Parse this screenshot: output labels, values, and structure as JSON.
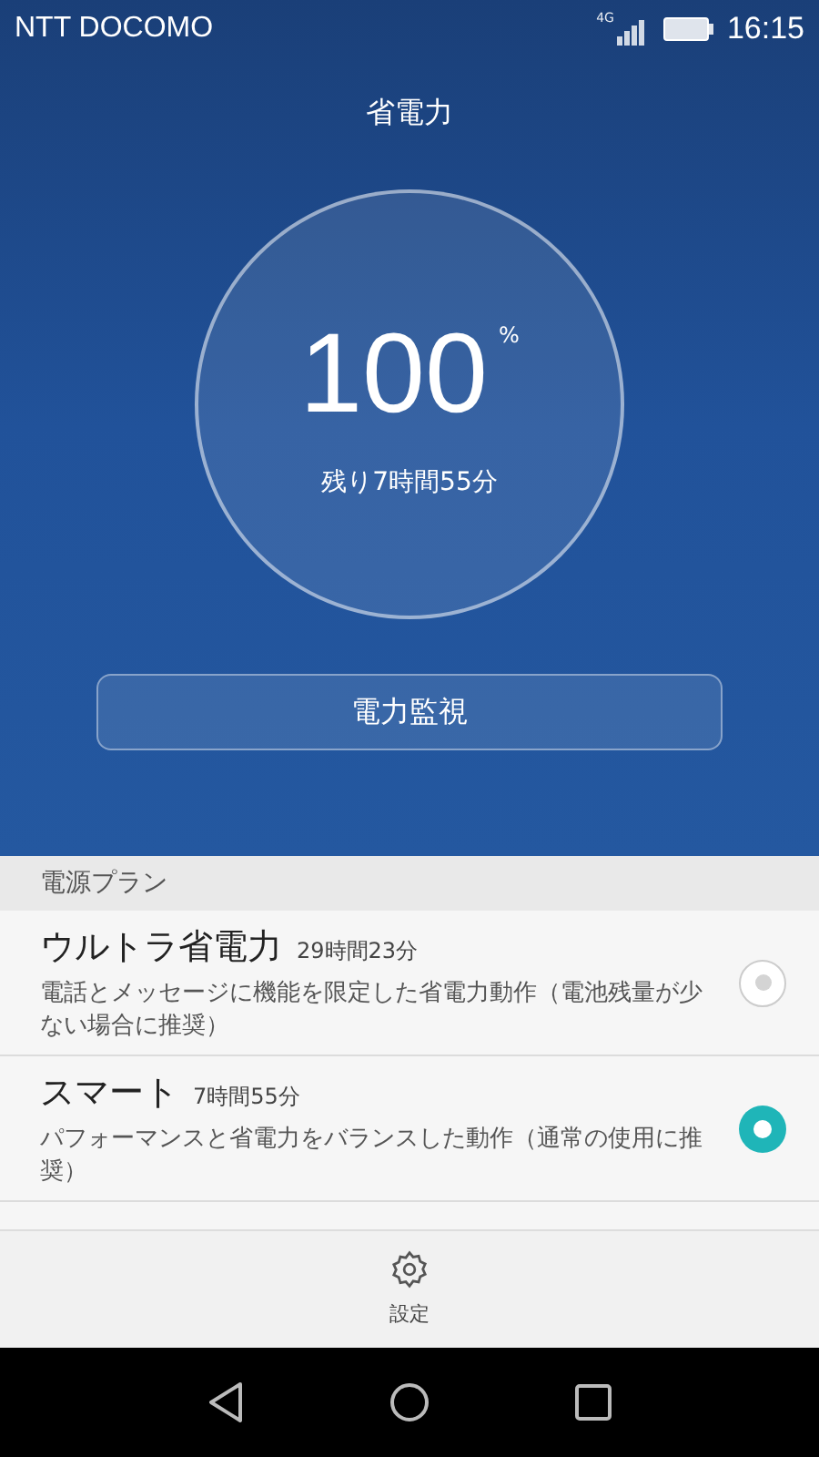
{
  "status_bar": {
    "carrier": "NTT DOCOMO",
    "network": "4G",
    "time": "16:15"
  },
  "title": "省電力",
  "battery": {
    "percent": "100",
    "unit": "%",
    "remaining": "残り7時間55分"
  },
  "monitor_button": "電力監視",
  "plans": {
    "header": "電源プラン",
    "items": [
      {
        "name": "ウルトラ省電力",
        "time": "29時間23分",
        "description": "電話とメッセージに機能を限定した省電力動作（電池残量が少ない場合に推奨）",
        "selected": false
      },
      {
        "name": "スマート",
        "time": "7時間55分",
        "description": "パフォーマンスと省電力をバランスした動作（通常の使用に推奨）",
        "selected": true
      }
    ]
  },
  "settings_button": "設定"
}
